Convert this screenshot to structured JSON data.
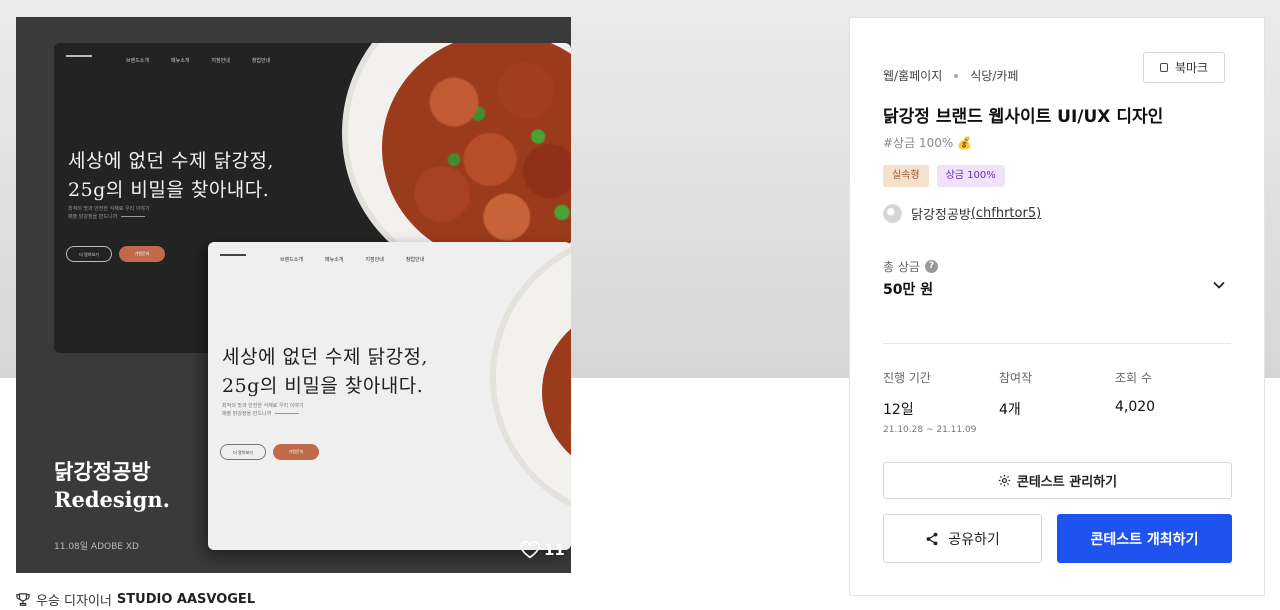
{
  "artwork": {
    "mock_nav": [
      "브랜드소개",
      "메뉴소개",
      "지점안내",
      "창업안내"
    ],
    "hero_line1": "세상에 없던 수제 닭강정,",
    "hero_line2": "25g의 비밀을 찾아내다.",
    "sub_line1": "최적의 맛과 안전한 식재료 우리 이야기",
    "sub_line2": "매출 닭강정을 만드니까",
    "btn_a": "더 알아보기",
    "btn_b": "가맹문의",
    "brand_title": "닭강정공방",
    "brand_subtitle": "Redesign.",
    "brand_meta": "11.08일 ADOBE XD",
    "likes": "11"
  },
  "designer": {
    "role": "우승 디자이너",
    "name": "STUDIO AASVOGEL"
  },
  "panel": {
    "category1": "웹/홈페이지",
    "category2": "식당/카페",
    "bookmark_label": "북마크",
    "title": "닭강정 브랜드 웹사이트 UI/UX 디자인",
    "tagline": "#상금 100% 💰",
    "badges": [
      "실속형",
      "상금 100%"
    ],
    "host_name": "닭강정공방",
    "host_handle": "(chfhrtor5)",
    "prize_label": "총 상금",
    "prize_value": "50만 원",
    "stats": [
      {
        "label": "진행 기간",
        "value": "12일",
        "detail": "21.10.28 ~ 21.11.09"
      },
      {
        "label": "참여작",
        "value": "4개"
      },
      {
        "label": "조회 수",
        "value": "4,020"
      }
    ],
    "manage_label": "콘테스트 관리하기",
    "share_label": "공유하기",
    "host_button_label": "콘테스트 개최하기"
  },
  "colors": {
    "primary": "#1f53f0",
    "badge1_bg": "#f6e1cf",
    "badge2_bg": "#efe3fb"
  }
}
